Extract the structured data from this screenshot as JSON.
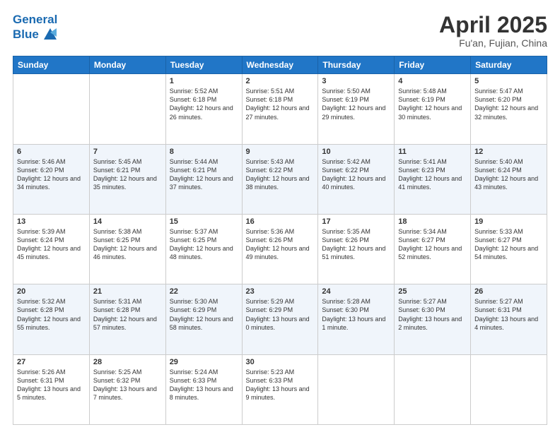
{
  "header": {
    "logo_line1": "General",
    "logo_line2": "Blue",
    "month": "April 2025",
    "location": "Fu'an, Fujian, China"
  },
  "weekdays": [
    "Sunday",
    "Monday",
    "Tuesday",
    "Wednesday",
    "Thursday",
    "Friday",
    "Saturday"
  ],
  "weeks": [
    [
      {
        "day": "",
        "info": ""
      },
      {
        "day": "",
        "info": ""
      },
      {
        "day": "1",
        "info": "Sunrise: 5:52 AM\nSunset: 6:18 PM\nDaylight: 12 hours and 26 minutes."
      },
      {
        "day": "2",
        "info": "Sunrise: 5:51 AM\nSunset: 6:18 PM\nDaylight: 12 hours and 27 minutes."
      },
      {
        "day": "3",
        "info": "Sunrise: 5:50 AM\nSunset: 6:19 PM\nDaylight: 12 hours and 29 minutes."
      },
      {
        "day": "4",
        "info": "Sunrise: 5:48 AM\nSunset: 6:19 PM\nDaylight: 12 hours and 30 minutes."
      },
      {
        "day": "5",
        "info": "Sunrise: 5:47 AM\nSunset: 6:20 PM\nDaylight: 12 hours and 32 minutes."
      }
    ],
    [
      {
        "day": "6",
        "info": "Sunrise: 5:46 AM\nSunset: 6:20 PM\nDaylight: 12 hours and 34 minutes."
      },
      {
        "day": "7",
        "info": "Sunrise: 5:45 AM\nSunset: 6:21 PM\nDaylight: 12 hours and 35 minutes."
      },
      {
        "day": "8",
        "info": "Sunrise: 5:44 AM\nSunset: 6:21 PM\nDaylight: 12 hours and 37 minutes."
      },
      {
        "day": "9",
        "info": "Sunrise: 5:43 AM\nSunset: 6:22 PM\nDaylight: 12 hours and 38 minutes."
      },
      {
        "day": "10",
        "info": "Sunrise: 5:42 AM\nSunset: 6:22 PM\nDaylight: 12 hours and 40 minutes."
      },
      {
        "day": "11",
        "info": "Sunrise: 5:41 AM\nSunset: 6:23 PM\nDaylight: 12 hours and 41 minutes."
      },
      {
        "day": "12",
        "info": "Sunrise: 5:40 AM\nSunset: 6:24 PM\nDaylight: 12 hours and 43 minutes."
      }
    ],
    [
      {
        "day": "13",
        "info": "Sunrise: 5:39 AM\nSunset: 6:24 PM\nDaylight: 12 hours and 45 minutes."
      },
      {
        "day": "14",
        "info": "Sunrise: 5:38 AM\nSunset: 6:25 PM\nDaylight: 12 hours and 46 minutes."
      },
      {
        "day": "15",
        "info": "Sunrise: 5:37 AM\nSunset: 6:25 PM\nDaylight: 12 hours and 48 minutes."
      },
      {
        "day": "16",
        "info": "Sunrise: 5:36 AM\nSunset: 6:26 PM\nDaylight: 12 hours and 49 minutes."
      },
      {
        "day": "17",
        "info": "Sunrise: 5:35 AM\nSunset: 6:26 PM\nDaylight: 12 hours and 51 minutes."
      },
      {
        "day": "18",
        "info": "Sunrise: 5:34 AM\nSunset: 6:27 PM\nDaylight: 12 hours and 52 minutes."
      },
      {
        "day": "19",
        "info": "Sunrise: 5:33 AM\nSunset: 6:27 PM\nDaylight: 12 hours and 54 minutes."
      }
    ],
    [
      {
        "day": "20",
        "info": "Sunrise: 5:32 AM\nSunset: 6:28 PM\nDaylight: 12 hours and 55 minutes."
      },
      {
        "day": "21",
        "info": "Sunrise: 5:31 AM\nSunset: 6:28 PM\nDaylight: 12 hours and 57 minutes."
      },
      {
        "day": "22",
        "info": "Sunrise: 5:30 AM\nSunset: 6:29 PM\nDaylight: 12 hours and 58 minutes."
      },
      {
        "day": "23",
        "info": "Sunrise: 5:29 AM\nSunset: 6:29 PM\nDaylight: 13 hours and 0 minutes."
      },
      {
        "day": "24",
        "info": "Sunrise: 5:28 AM\nSunset: 6:30 PM\nDaylight: 13 hours and 1 minute."
      },
      {
        "day": "25",
        "info": "Sunrise: 5:27 AM\nSunset: 6:30 PM\nDaylight: 13 hours and 2 minutes."
      },
      {
        "day": "26",
        "info": "Sunrise: 5:27 AM\nSunset: 6:31 PM\nDaylight: 13 hours and 4 minutes."
      }
    ],
    [
      {
        "day": "27",
        "info": "Sunrise: 5:26 AM\nSunset: 6:31 PM\nDaylight: 13 hours and 5 minutes."
      },
      {
        "day": "28",
        "info": "Sunrise: 5:25 AM\nSunset: 6:32 PM\nDaylight: 13 hours and 7 minutes."
      },
      {
        "day": "29",
        "info": "Sunrise: 5:24 AM\nSunset: 6:33 PM\nDaylight: 13 hours and 8 minutes."
      },
      {
        "day": "30",
        "info": "Sunrise: 5:23 AM\nSunset: 6:33 PM\nDaylight: 13 hours and 9 minutes."
      },
      {
        "day": "",
        "info": ""
      },
      {
        "day": "",
        "info": ""
      },
      {
        "day": "",
        "info": ""
      }
    ]
  ]
}
